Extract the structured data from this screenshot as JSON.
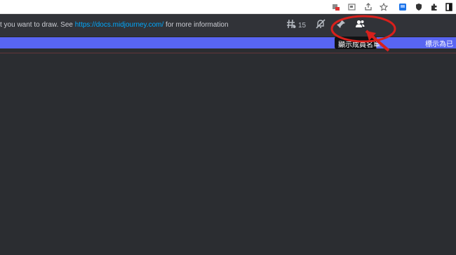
{
  "browser": {
    "icons": [
      "translate-icon",
      "tab-icon",
      "share-icon",
      "star-icon",
      "extension-icon",
      "shield-icon",
      "puzzle-icon",
      "sidepanel-icon"
    ]
  },
  "header": {
    "topic_prefix": "t you want to draw. See ",
    "topic_link": "https://docs.midjourney.com/",
    "topic_suffix": " for more information",
    "thread_count": "15"
  },
  "tooltip": {
    "text": "顯示成員名單"
  },
  "banner": {
    "text": "標示為已"
  },
  "colors": {
    "header_bg": "#313338",
    "messages_bg": "#2b2d31",
    "banner_bg": "#5865f2",
    "link": "#00a8fc",
    "annotation": "#d8201c"
  }
}
